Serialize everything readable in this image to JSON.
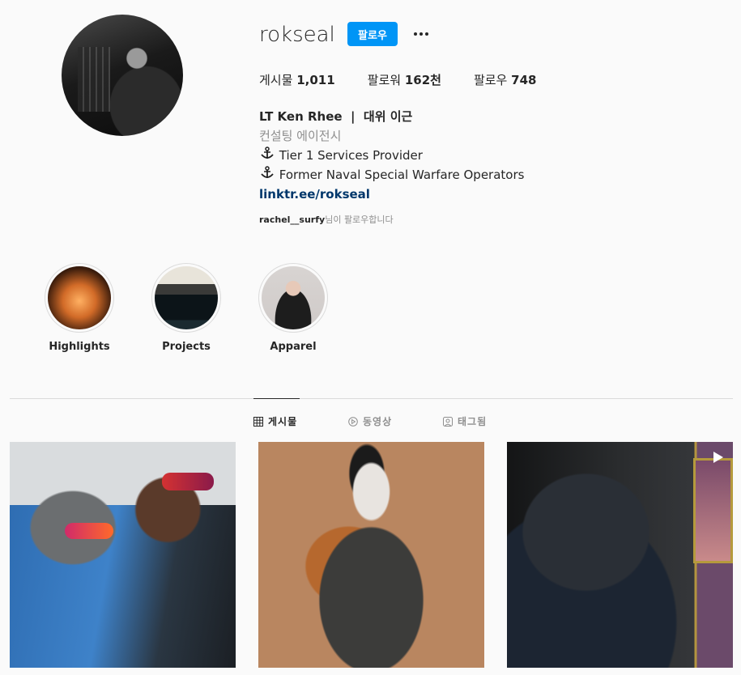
{
  "profile": {
    "username": "rokseal",
    "follow_label": "팔로우",
    "stats": {
      "posts_label": "게시물",
      "posts_value": "1,011",
      "followers_label": "팔로워",
      "followers_value": "162천",
      "following_label": "팔로우",
      "following_value": "748"
    },
    "bio": {
      "full_name": "LT Ken Rhee  |  대위 이근",
      "category": "컨설팅 에이전시",
      "lines": [
        "Tier 1 Services Provider",
        "Former Naval Special Warfare Operators"
      ],
      "link": "linktr.ee/rokseal"
    },
    "followed_by": {
      "name": "rachel__surfy",
      "suffix": "님이 팔로우합니다"
    }
  },
  "highlights": [
    {
      "label": "Highlights"
    },
    {
      "label": "Projects"
    },
    {
      "label": "Apparel"
    }
  ],
  "tabs": [
    {
      "label": "게시물",
      "icon": "grid-icon",
      "active": true
    },
    {
      "label": "동영상",
      "icon": "play-circle-icon",
      "active": false
    },
    {
      "label": "태그됨",
      "icon": "tag-user-icon",
      "active": false
    }
  ],
  "colors": {
    "accent": "#0095f6",
    "link": "#00376b",
    "muted": "#8e8e8e",
    "text": "#262626"
  }
}
